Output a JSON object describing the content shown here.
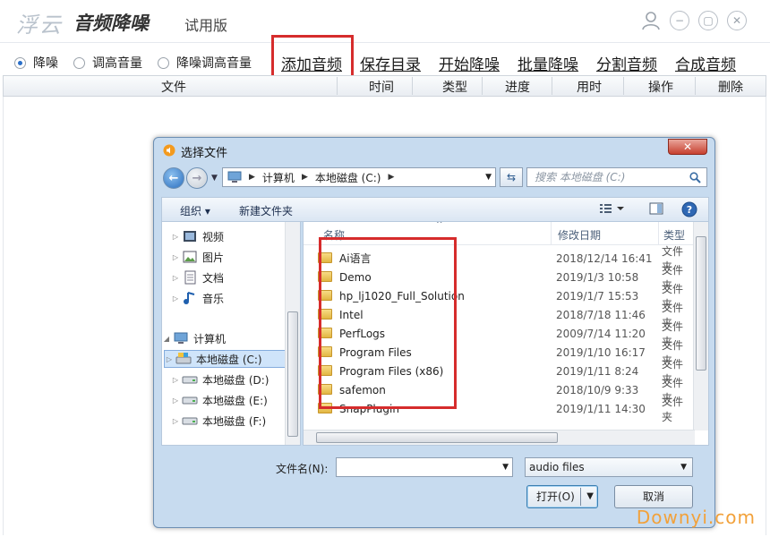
{
  "app": {
    "logo": "浮云",
    "title": "音频降噪",
    "edition": "试用版"
  },
  "toolbar": {
    "radios": [
      {
        "label": "降噪",
        "selected": true
      },
      {
        "label": "调高音量",
        "selected": false
      },
      {
        "label": "降噪调高音量",
        "selected": false
      }
    ],
    "actions": [
      "添加音频",
      "保存目录",
      "开始降噪",
      "批量降噪",
      "分割音频",
      "合成音频"
    ]
  },
  "table": {
    "columns": [
      "文件",
      "时间",
      "类型",
      "进度",
      "用时",
      "操作",
      "删除"
    ]
  },
  "dialog": {
    "title": "选择文件",
    "close": "✕",
    "address": [
      "计算机",
      "本地磁盘 (C:)"
    ],
    "search_placeholder": "搜索 本地磁盘 (C:)",
    "commands": {
      "organize": "组织 ▾",
      "new_folder": "新建文件夹"
    },
    "nav_tree": [
      {
        "label": "视频",
        "icon": "video-icon"
      },
      {
        "label": "图片",
        "icon": "picture-icon"
      },
      {
        "label": "文档",
        "icon": "document-icon"
      },
      {
        "label": "音乐",
        "icon": "music-icon"
      },
      {
        "label": "计算机",
        "icon": "computer-icon"
      },
      {
        "label": "本地磁盘 (C:)",
        "icon": "drive-icon",
        "selected": true
      },
      {
        "label": "本地磁盘 (D:)",
        "icon": "drive-icon"
      },
      {
        "label": "本地磁盘 (E:)",
        "icon": "drive-icon"
      },
      {
        "label": "本地磁盘 (F:)",
        "icon": "drive-icon"
      }
    ],
    "file_columns": {
      "name": "名称",
      "date": "修改日期",
      "type": "类型"
    },
    "files": [
      {
        "name": "Ai语言",
        "date": "2018/12/14 16:41",
        "type": "文件夹"
      },
      {
        "name": "Demo",
        "date": "2019/1/3 10:58",
        "type": "文件夹"
      },
      {
        "name": "hp_lj1020_Full_Solution",
        "date": "2019/1/7 15:53",
        "type": "文件夹"
      },
      {
        "name": "Intel",
        "date": "2018/7/18 11:46",
        "type": "文件夹"
      },
      {
        "name": "PerfLogs",
        "date": "2009/7/14 11:20",
        "type": "文件夹"
      },
      {
        "name": "Program Files",
        "date": "2019/1/10 16:17",
        "type": "文件夹"
      },
      {
        "name": "Program Files (x86)",
        "date": "2019/1/11 8:24",
        "type": "文件夹"
      },
      {
        "name": "safemon",
        "date": "2018/10/9 9:33",
        "type": "文件夹"
      },
      {
        "name": "SnapPlugin",
        "date": "2019/1/11 14:30",
        "type": "文件夹"
      }
    ],
    "filename_label": "文件名(N):",
    "filename_value": "",
    "filetype": "audio files",
    "open_button": "打开(O)",
    "cancel_button": "取消"
  },
  "watermark": "Downyi.com",
  "colors": {
    "highlight": "#d62c2c",
    "selection": "#cfe4fa",
    "dialog_frame": "#c7dbef"
  }
}
